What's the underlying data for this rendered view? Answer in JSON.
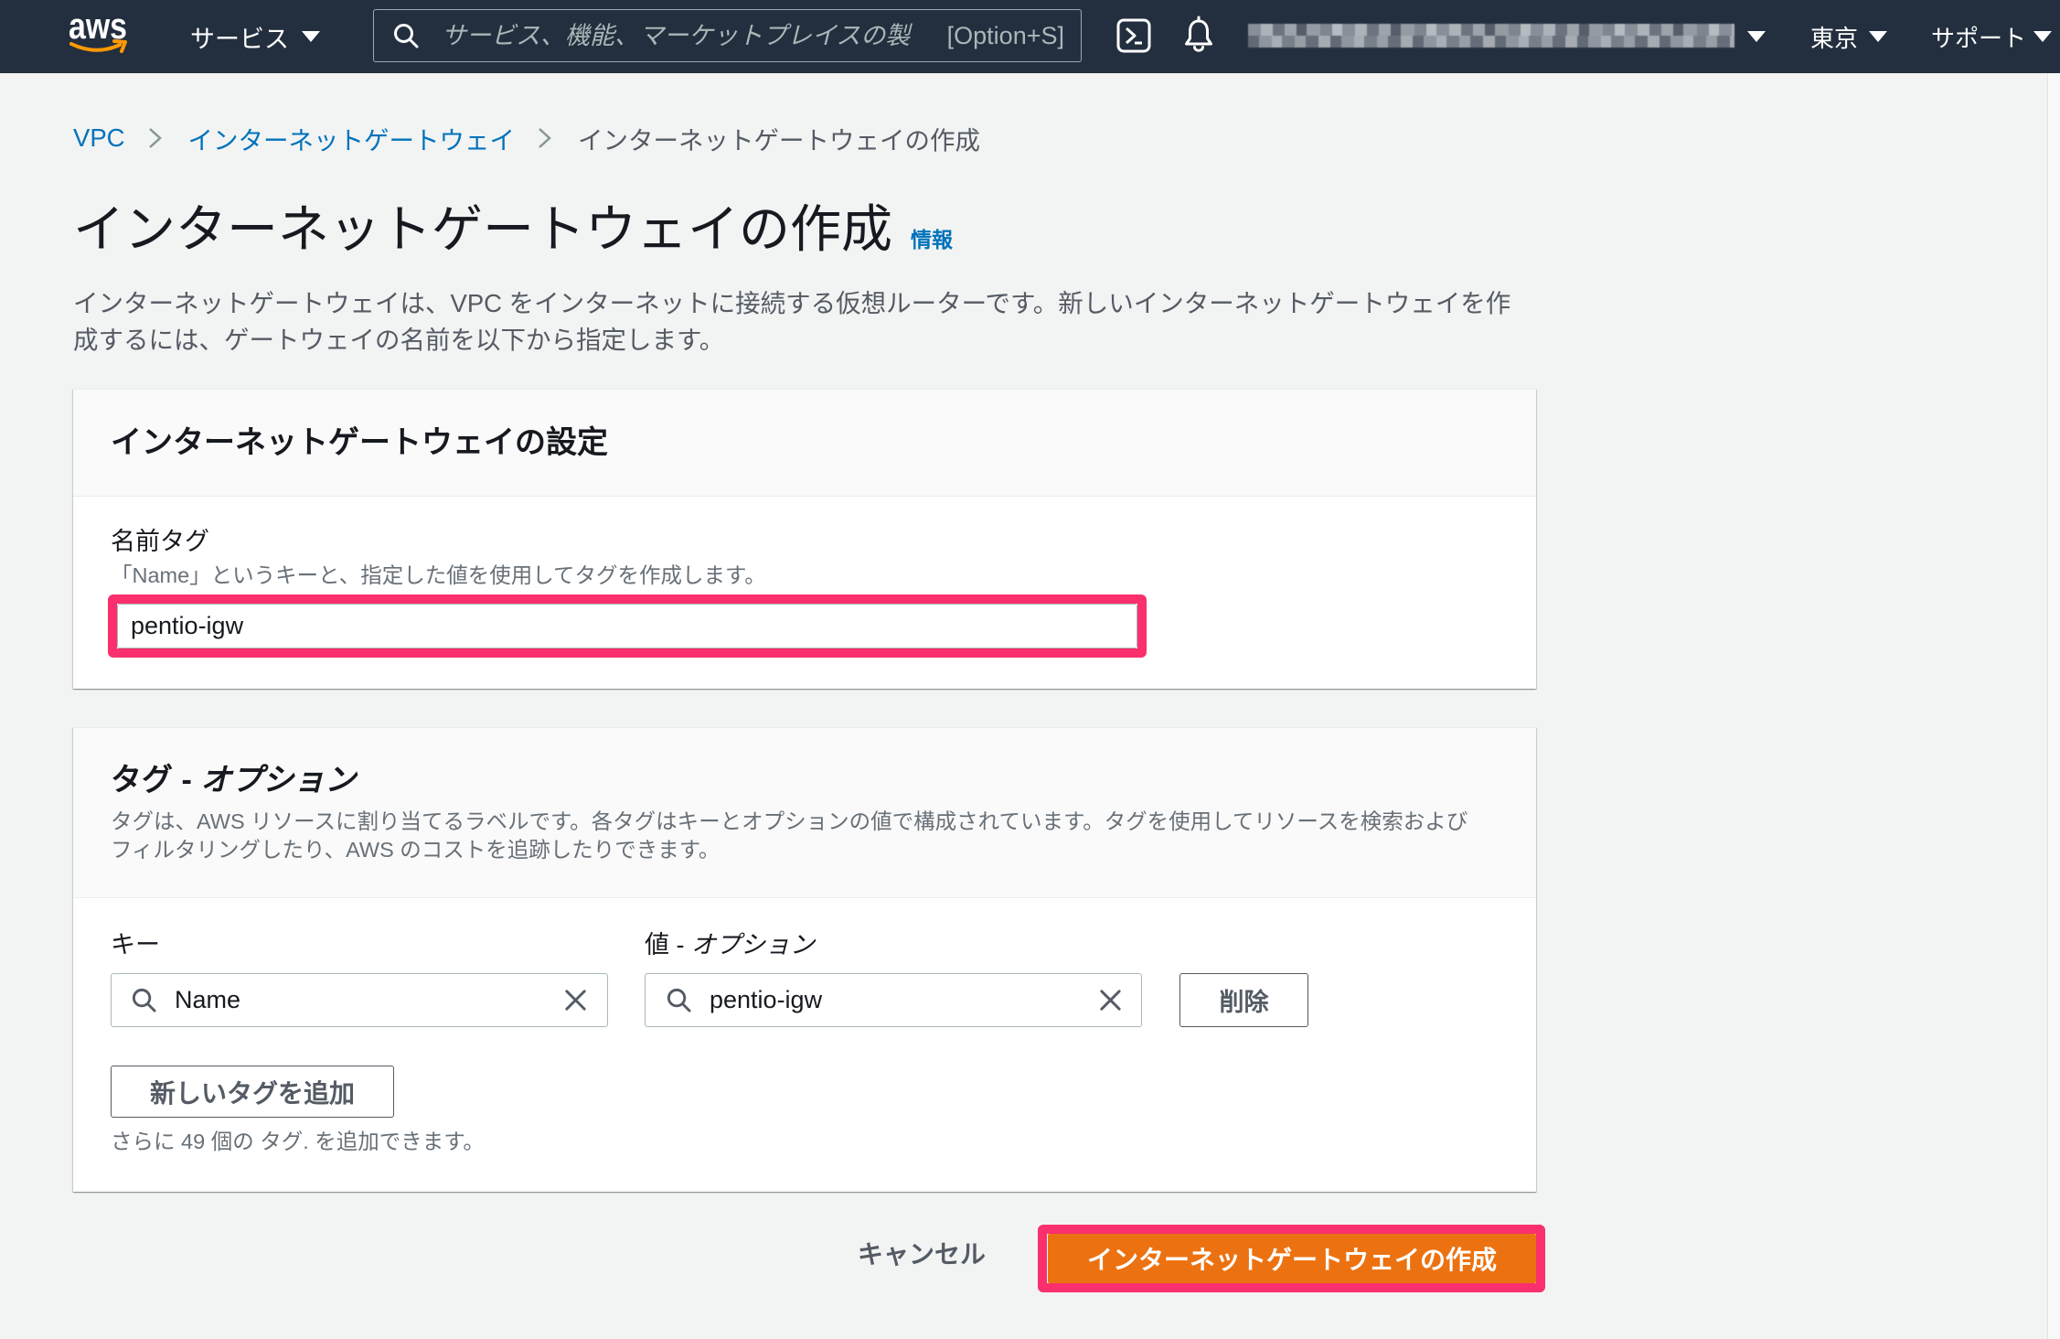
{
  "theme": {
    "nav_bg": "#232f3e",
    "page_bg": "#f2f3f3",
    "link": "#0073bb",
    "primary": "#ec7211",
    "annotation": "#f9306d",
    "logo_orange": "#ff9900"
  },
  "icons": {
    "nav": [
      "search-icon",
      "cloudshell-icon",
      "bell-icon",
      "caret-down-icon"
    ],
    "breadcrumb_separator": "chevron-right-icon",
    "tag_inputs": [
      "search-icon",
      "close-icon"
    ]
  },
  "nav": {
    "logo_text": "aws",
    "services_label": "サービス",
    "search": {
      "placeholder": "サービス、機能、マーケットプレイスの製",
      "shortcut": "[Option+S]"
    },
    "region_label": "東京",
    "support_label": "サポート"
  },
  "breadcrumb": [
    {
      "label": "VPC"
    },
    {
      "label": "インターネットゲートウェイ"
    },
    {
      "label": "インターネットゲートウェイの作成"
    }
  ],
  "page": {
    "title": "インターネットゲートウェイの作成",
    "info_link": "情報",
    "description": "インターネットゲートウェイは、VPC をインターネットに接続する仮想ルーターです。新しいインターネットゲートウェイを作成するには、ゲートウェイの名前を以下から指定します。"
  },
  "settings_panel": {
    "header": "インターネットゲートウェイの設定",
    "name_tag": {
      "label": "名前タグ",
      "description": "「Name」というキーと、指定した値を使用してタグを作成します。",
      "value": "pentio-igw"
    }
  },
  "tags_panel": {
    "header": "タグ - ",
    "header_optional": "オプション",
    "description": "タグは、AWS リソースに割り当てるラベルです。各タグはキーとオプションの値で構成されています。タグを使用してリソースを検索およびフィルタリングしたり、AWS のコストを追跡したりできます。",
    "key_label": "キー",
    "value_label": "値 - ",
    "value_label_optional": "オプション",
    "rows": [
      {
        "key": "Name",
        "value": "pentio-igw",
        "remove_label": "削除"
      }
    ],
    "add_label": "新しいタグを追加",
    "remaining_text": "さらに 49 個の タグ. を追加できます。"
  },
  "footer": {
    "cancel_label": "キャンセル",
    "create_label": "インターネットゲートウェイの作成"
  }
}
